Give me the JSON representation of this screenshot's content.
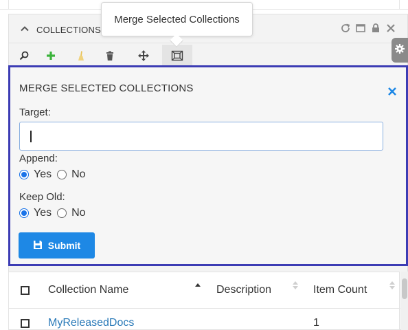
{
  "panel": {
    "title": "COLLECTIONS"
  },
  "toolbar": {
    "items": [
      {
        "icon": "search-icon"
      },
      {
        "icon": "add-icon",
        "color": "#3bb33b"
      },
      {
        "icon": "broom-icon",
        "color": "#e8c256"
      },
      {
        "icon": "trash-icon"
      },
      {
        "icon": "move-icon"
      },
      {
        "icon": "merge-icon"
      }
    ]
  },
  "tooltip": {
    "text": "Merge Selected Collections"
  },
  "merge": {
    "title": "MERGE SELECTED COLLECTIONS",
    "target_label": "Target:",
    "target_value": "",
    "append_label": "Append:",
    "keep_old_label": "Keep Old:",
    "yes_label": "Yes",
    "no_label": "No",
    "append_selected": "Yes",
    "keep_old_selected": "Yes",
    "submit_label": "Submit",
    "accent": "#3c3cb4",
    "button_color": "#1e88e5"
  },
  "table": {
    "columns": [
      "Collection Name",
      "Description",
      "Item Count"
    ],
    "rows": [
      {
        "name": "MyReleasedDocs",
        "description": "",
        "item_count": "1"
      }
    ]
  }
}
